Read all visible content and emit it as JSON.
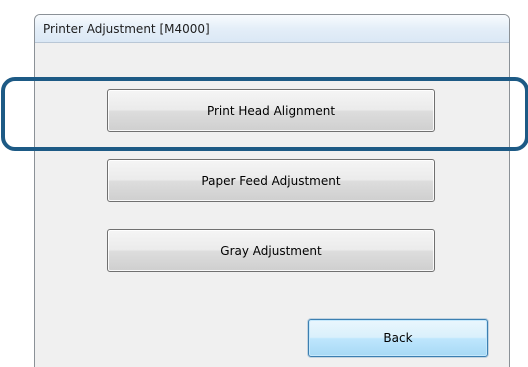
{
  "window": {
    "title": "Printer Adjustment [M4000]"
  },
  "buttons": {
    "print_head_alignment": "Print Head Alignment",
    "paper_feed_adjustment": "Paper Feed Adjustment",
    "gray_adjustment": "Gray Adjustment",
    "back": "Back"
  },
  "colors": {
    "highlight_outline": "#1d5a85",
    "default_button_border": "#3c7fb1",
    "window_background": "#f0f0f0"
  }
}
